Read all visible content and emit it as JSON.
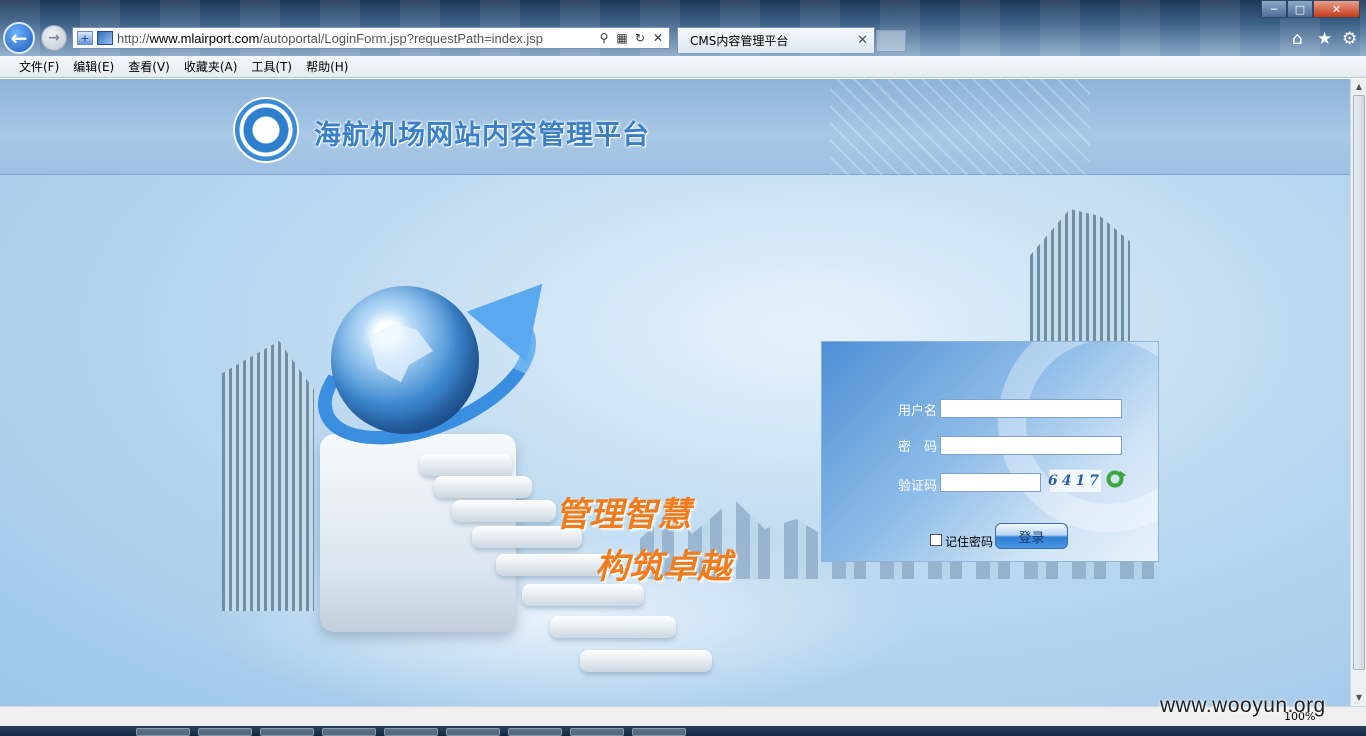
{
  "browser": {
    "url": "http://www.mlairport.com/autoportal/LoginForm.jsp?requestPath=index.jsp",
    "tab_title": "CMS内容管理平台",
    "zoom": "100%",
    "menu": [
      "文件(F)",
      "编辑(E)",
      "查看(V)",
      "收藏夹(A)",
      "工具(T)",
      "帮助(H)"
    ]
  },
  "page": {
    "site_title": "海航机场网站内容管理平台",
    "slogan_line1": "管理智慧",
    "slogan_line2": "构筑卓越"
  },
  "login": {
    "username_label": "用户名",
    "password_label": "密　码",
    "captcha_label": "验证码",
    "captcha_code": "6417",
    "remember_label": "记住密码",
    "submit_label": "登录"
  },
  "watermark": "www.wooyun.org",
  "icons": [
    "back-arrow-icon",
    "forward-arrow-icon",
    "home-icon",
    "star-icon",
    "gear-icon",
    "refresh-icon",
    "logo-icon"
  ]
}
